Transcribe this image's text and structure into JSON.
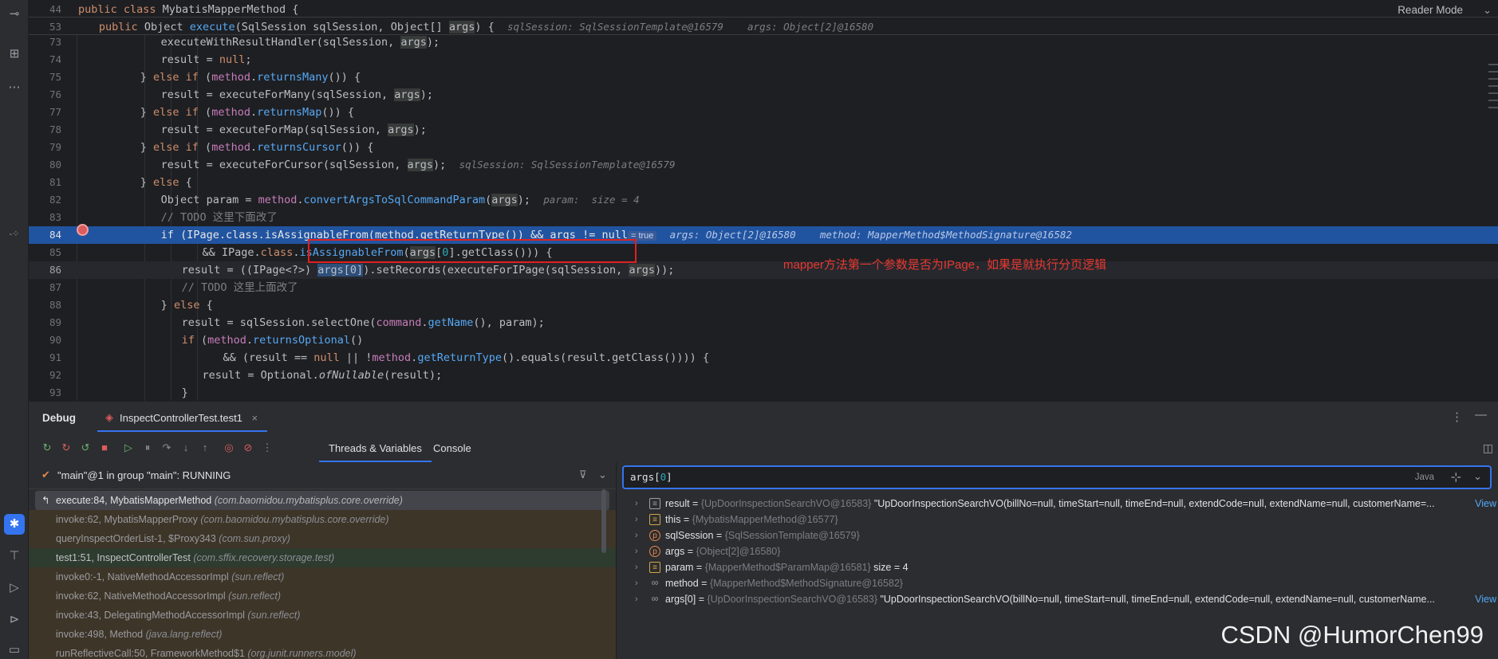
{
  "editor": {
    "reader_mode": "Reader Mode",
    "sticky": [
      {
        "num": "44",
        "indent": 0,
        "tokens": [
          [
            "kw",
            "public class "
          ],
          [
            "",
            "MybatisMapperMethod {"
          ]
        ]
      },
      {
        "num": "53",
        "indent": 4,
        "tokens": [
          [
            "kw",
            "public "
          ],
          [
            "",
            "Object "
          ],
          [
            "fn",
            "execute"
          ],
          [
            "",
            "(SqlSession sqlSession, Object[] "
          ],
          [
            "arg",
            "args"
          ],
          [
            "",
            ") {  "
          ],
          [
            "hint",
            "sqlSession: SqlSessionTemplate@16579    args: Object[2]@16580"
          ]
        ]
      }
    ],
    "lines": [
      {
        "num": "73",
        "indent": 16,
        "tokens": [
          [
            "",
            "executeWithResultHandler(sqlSession, "
          ],
          [
            "arg",
            "args"
          ],
          [
            "",
            ");"
          ]
        ]
      },
      {
        "num": "74",
        "indent": 16,
        "tokens": [
          [
            "",
            "result = "
          ],
          [
            "kw",
            "null"
          ],
          [
            "",
            ";"
          ]
        ]
      },
      {
        "num": "75",
        "indent": 12,
        "tokens": [
          [
            "",
            "} "
          ],
          [
            "kw",
            "else if "
          ],
          [
            "",
            "("
          ],
          [
            "fld",
            "method"
          ],
          [
            "",
            "."
          ],
          [
            "fn",
            "returnsMany"
          ],
          [
            "",
            "()) {"
          ]
        ]
      },
      {
        "num": "76",
        "indent": 16,
        "tokens": [
          [
            "",
            "result = executeForMany(sqlSession, "
          ],
          [
            "arg",
            "args"
          ],
          [
            "",
            ");"
          ]
        ]
      },
      {
        "num": "77",
        "indent": 12,
        "tokens": [
          [
            "",
            "} "
          ],
          [
            "kw",
            "else if "
          ],
          [
            "",
            "("
          ],
          [
            "fld",
            "method"
          ],
          [
            "",
            "."
          ],
          [
            "fn",
            "returnsMap"
          ],
          [
            "",
            "()) {"
          ]
        ]
      },
      {
        "num": "78",
        "indent": 16,
        "tokens": [
          [
            "",
            "result = executeForMap(sqlSession, "
          ],
          [
            "arg",
            "args"
          ],
          [
            "",
            ");"
          ]
        ]
      },
      {
        "num": "79",
        "indent": 12,
        "tokens": [
          [
            "",
            "} "
          ],
          [
            "kw",
            "else if "
          ],
          [
            "",
            "("
          ],
          [
            "fld",
            "method"
          ],
          [
            "",
            "."
          ],
          [
            "fn",
            "returnsCursor"
          ],
          [
            "",
            "()) {"
          ]
        ]
      },
      {
        "num": "80",
        "indent": 16,
        "tokens": [
          [
            "",
            "result = executeForCursor(sqlSession, "
          ],
          [
            "arg",
            "args"
          ],
          [
            "",
            ");  "
          ],
          [
            "hint",
            "sqlSession: SqlSessionTemplate@16579"
          ]
        ]
      },
      {
        "num": "81",
        "indent": 12,
        "tokens": [
          [
            "",
            "} "
          ],
          [
            "kw",
            "else "
          ],
          [
            "",
            "{"
          ]
        ]
      },
      {
        "num": "82",
        "indent": 16,
        "tokens": [
          [
            "",
            "Object param = "
          ],
          [
            "fld",
            "method"
          ],
          [
            "",
            "."
          ],
          [
            "fn",
            "convertArgsToSqlCommandParam"
          ],
          [
            "",
            "("
          ],
          [
            "arg",
            "args"
          ],
          [
            "",
            ");  "
          ],
          [
            "hint",
            "param:  size = 4"
          ]
        ]
      },
      {
        "num": "83",
        "indent": 16,
        "tokens": [
          [
            "cmt",
            "// TODO 这里下面改了"
          ]
        ]
      },
      {
        "num": "84",
        "indent": 16,
        "hl": true,
        "tokens": [
          [
            "kw",
            "if "
          ],
          [
            "",
            "(IPage."
          ],
          [
            "kw",
            "class"
          ],
          [
            "",
            "."
          ],
          [
            "fn",
            "isAssignableFrom"
          ],
          [
            "",
            "("
          ],
          [
            "fld",
            "method"
          ],
          [
            "",
            "."
          ],
          [
            "fn",
            "getReturnType"
          ],
          [
            "",
            "()) && args != "
          ],
          [
            "kw",
            "null"
          ],
          [
            "badge",
            "= true"
          ],
          [
            "",
            "  "
          ],
          [
            "hint",
            "args: Object[2]@16580    method: MapperMethod$MethodSignature@16582"
          ]
        ]
      },
      {
        "num": "85",
        "indent": 24,
        "tokens": [
          [
            "",
            "&& IPage."
          ],
          [
            "kw",
            "class"
          ],
          [
            "",
            "."
          ],
          [
            "fn",
            "isAssignableFrom"
          ],
          [
            "",
            "("
          ],
          [
            "arg",
            "args"
          ],
          [
            "",
            "["
          ],
          [
            "num",
            "0"
          ],
          [
            "",
            "].getClass())) {"
          ]
        ]
      },
      {
        "num": "86",
        "indent": 20,
        "cur": true,
        "tokens": [
          [
            "",
            "result = ((IPage<?>) "
          ],
          [
            "argsel",
            "args[0]"
          ],
          [
            "",
            ").setRecords(executeForIPage(sqlSession, "
          ],
          [
            "arg",
            "args"
          ],
          [
            "",
            "));"
          ]
        ]
      },
      {
        "num": "87",
        "indent": 20,
        "tokens": [
          [
            "cmt",
            "// TODO 这里上面改了"
          ]
        ]
      },
      {
        "num": "88",
        "indent": 16,
        "tokens": [
          [
            "",
            "} "
          ],
          [
            "kw",
            "else "
          ],
          [
            "",
            "{"
          ]
        ]
      },
      {
        "num": "89",
        "indent": 20,
        "tokens": [
          [
            "",
            "result = sqlSession.selectOne("
          ],
          [
            "fld",
            "command"
          ],
          [
            "",
            "."
          ],
          [
            "fn",
            "getName"
          ],
          [
            "",
            "(), param);"
          ]
        ]
      },
      {
        "num": "90",
        "indent": 20,
        "tokens": [
          [
            "kw",
            "if "
          ],
          [
            "",
            "("
          ],
          [
            "fld",
            "method"
          ],
          [
            "",
            "."
          ],
          [
            "fn",
            "returnsOptional"
          ],
          [
            "",
            "()"
          ]
        ]
      },
      {
        "num": "91",
        "indent": 28,
        "tokens": [
          [
            "",
            "&& (result == "
          ],
          [
            "kw",
            "null "
          ],
          [
            "",
            "|| !"
          ],
          [
            "fld",
            "method"
          ],
          [
            "",
            "."
          ],
          [
            "fn",
            "getReturnType"
          ],
          [
            "",
            "().equals(result.getClass()))) {"
          ]
        ]
      },
      {
        "num": "92",
        "indent": 24,
        "tokens": [
          [
            "",
            "result = Optional."
          ],
          [
            "it",
            "ofNullable"
          ],
          [
            "",
            "(result);"
          ]
        ]
      },
      {
        "num": "93",
        "indent": 20,
        "tokens": [
          [
            "",
            "}"
          ]
        ]
      }
    ],
    "annotation": "mapper方法第一个参数是否为IPage，如果是就执行分页逻辑"
  },
  "debug": {
    "title": "Debug",
    "session_tab": "InspectControllerTest.test1",
    "tabs": [
      "Threads & Variables",
      "Console"
    ],
    "thread": "\"main\"@1 in group \"main\": RUNNING",
    "frames": [
      {
        "name": "execute:84, MybatisMapperMethod",
        "pkg": "(com.baomidou.mybatisplus.core.override)",
        "kind": "sel"
      },
      {
        "name": "invoke:62, MybatisMapperProxy",
        "pkg": "(com.baomidou.mybatisplus.core.override)",
        "kind": "lib"
      },
      {
        "name": "queryInspectOrderList-1, $Proxy343",
        "pkg": "(com.sun.proxy)",
        "kind": "lib"
      },
      {
        "name": "test1:51, InspectControllerTest",
        "pkg": "(com.sffix.recovery.storage.test)",
        "kind": "green"
      },
      {
        "name": "invoke0:-1, NativeMethodAccessorImpl",
        "pkg": "(sun.reflect)",
        "kind": "lib"
      },
      {
        "name": "invoke:62, NativeMethodAccessorImpl",
        "pkg": "(sun.reflect)",
        "kind": "lib"
      },
      {
        "name": "invoke:43, DelegatingMethodAccessorImpl",
        "pkg": "(sun.reflect)",
        "kind": "lib"
      },
      {
        "name": "invoke:498, Method",
        "pkg": "(java.lang.reflect)",
        "kind": "lib"
      },
      {
        "name": "runReflectiveCall:50, FrameworkMethod$1",
        "pkg": "(org.junit.runners.model)",
        "kind": "lib"
      }
    ],
    "eval": {
      "expression": "args[0]",
      "lang": "Java"
    },
    "variables": [
      {
        "icon": "list",
        "name": "result",
        "type": "{UpDoorInspectionSearchVO@16583}",
        "value": "\"UpDoorInspectionSearchVO(billNo=null, timeStart=null, timeEnd=null, extendCode=null, extendName=null, customerName=...",
        "link": "View"
      },
      {
        "icon": "field",
        "name": "this",
        "type": "{MybatisMapperMethod@16577}",
        "value": "",
        "link": ""
      },
      {
        "icon": "p",
        "name": "sqlSession",
        "type": "{SqlSessionTemplate@16579}",
        "value": "",
        "link": ""
      },
      {
        "icon": "p",
        "name": "args",
        "type": "{Object[2]@16580}",
        "value": "",
        "link": ""
      },
      {
        "icon": "field",
        "name": "param",
        "type": "{MapperMethod$ParamMap@16581}",
        "value": " size = 4",
        "link": ""
      },
      {
        "icon": "oo",
        "name": "method",
        "type": "{MapperMethod$MethodSignature@16582}",
        "value": "",
        "link": ""
      },
      {
        "icon": "oo",
        "name": "args[0]",
        "type": "{UpDoorInspectionSearchVO@16583}",
        "value": "\"UpDoorInspectionSearchVO(billNo=null, timeStart=null, timeEnd=null, extendCode=null, extendName=null, customerName...",
        "link": "View"
      }
    ]
  },
  "watermark": "CSDN @HumorChen99"
}
